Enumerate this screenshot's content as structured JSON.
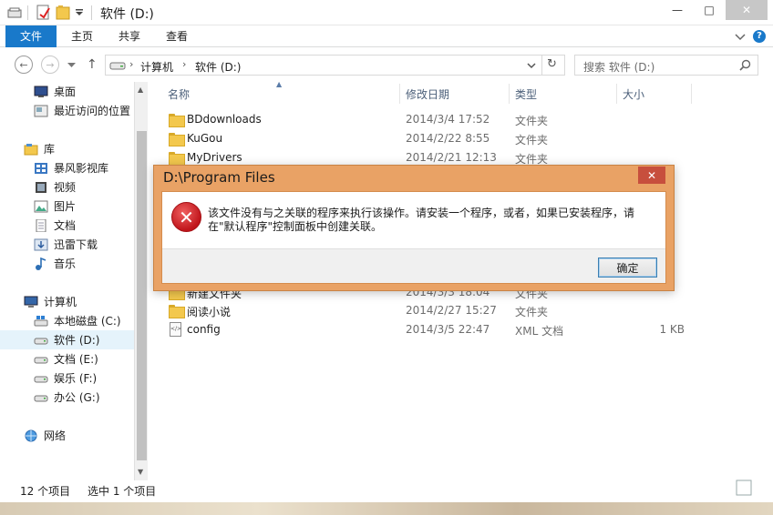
{
  "window": {
    "title": "软件 (D:)",
    "minimize": "—",
    "maximize": "□",
    "close": "✕"
  },
  "ribbon": {
    "tabs": [
      "文件",
      "主页",
      "共享",
      "查看"
    ]
  },
  "address": {
    "crumbs": [
      "计算机",
      "软件 (D:)"
    ],
    "search_placeholder": "搜索 软件 (D:)"
  },
  "nav": {
    "items": [
      {
        "label": "桌面",
        "icon": "desktop-icon"
      },
      {
        "label": "最近访问的位置",
        "icon": "recent-places-icon"
      },
      {
        "label": "库",
        "icon": "library-icon"
      },
      {
        "label": "暴风影视库",
        "icon": "video-library-icon"
      },
      {
        "label": "视频",
        "icon": "video-icon"
      },
      {
        "label": "图片",
        "icon": "pictures-icon"
      },
      {
        "label": "文档",
        "icon": "documents-icon"
      },
      {
        "label": "迅雷下载",
        "icon": "downloads-icon"
      },
      {
        "label": "音乐",
        "icon": "music-icon"
      },
      {
        "label": "计算机",
        "icon": "computer-icon"
      },
      {
        "label": "本地磁盘 (C:)",
        "icon": "drive-c-icon"
      },
      {
        "label": "软件 (D:)",
        "icon": "drive-icon"
      },
      {
        "label": "文档 (E:)",
        "icon": "drive-icon"
      },
      {
        "label": "娱乐 (F:)",
        "icon": "drive-icon"
      },
      {
        "label": "办公 (G:)",
        "icon": "drive-icon"
      },
      {
        "label": "网络",
        "icon": "network-icon"
      }
    ]
  },
  "columns": {
    "name": "名称",
    "date": "修改日期",
    "type": "类型",
    "size": "大小"
  },
  "files": [
    {
      "name": "BDdownloads",
      "date": "2014/3/4 17:52",
      "type": "文件夹",
      "size": ""
    },
    {
      "name": "KuGou",
      "date": "2014/2/22 8:55",
      "type": "文件夹",
      "size": ""
    },
    {
      "name": "MyDrivers",
      "date": "2014/2/21 12:13",
      "type": "文件夹",
      "size": ""
    },
    {
      "name": "新建文件夹",
      "date": "2014/3/3 18:04",
      "type": "文件夹",
      "size": ""
    },
    {
      "name": "阅读小说",
      "date": "2014/2/27 15:27",
      "type": "文件夹",
      "size": ""
    },
    {
      "name": "config",
      "date": "2014/3/5 22:47",
      "type": "XML 文档",
      "size": "1 KB"
    }
  ],
  "status": {
    "count": "12 个项目",
    "selected": "选中 1 个项目"
  },
  "dialog": {
    "title": "D:\\Program Files",
    "close": "✕",
    "message": "该文件没有与之关联的程序来执行该操作。请安装一个程序，或者，如果已安装程序，请在\"默认程序\"控制面板中创建关联。",
    "ok": "确定"
  },
  "colors": {
    "accent": "#1979ca",
    "dialog_frame": "#e9a265",
    "dialog_close": "#c74f3d"
  }
}
